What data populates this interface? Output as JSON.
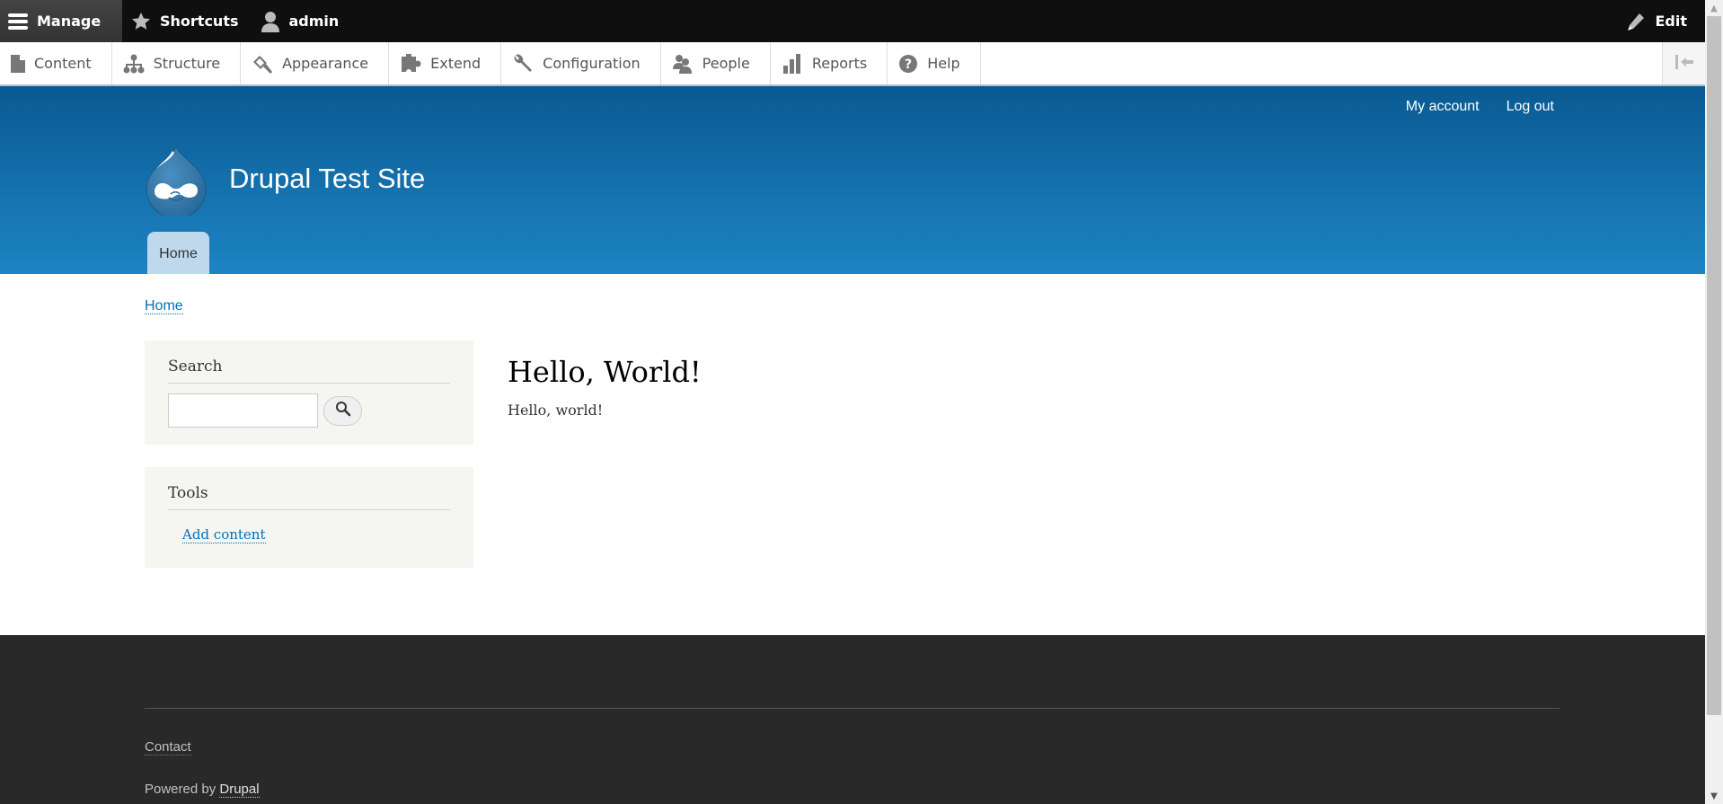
{
  "admin_toolbar": {
    "manage_label": "Manage",
    "shortcuts_label": "Shortcuts",
    "user_label": "admin",
    "edit_label": "Edit"
  },
  "admin_tray": {
    "items": [
      {
        "label": "Content",
        "icon": "file-icon"
      },
      {
        "label": "Structure",
        "icon": "sitemap-icon"
      },
      {
        "label": "Appearance",
        "icon": "paintbrush-icon"
      },
      {
        "label": "Extend",
        "icon": "puzzle-icon"
      },
      {
        "label": "Configuration",
        "icon": "wrench-icon"
      },
      {
        "label": "People",
        "icon": "people-icon"
      },
      {
        "label": "Reports",
        "icon": "bar-chart-icon"
      },
      {
        "label": "Help",
        "icon": "question-icon"
      }
    ],
    "toggle_icon": "collapse-orientation-icon"
  },
  "header": {
    "site_name": "Drupal Test Site",
    "secondary_menu": [
      "My account",
      "Log out"
    ],
    "primary_menu": [
      "Home"
    ],
    "colors": {
      "top": "#0a5a92",
      "bottom": "#1d84c3"
    }
  },
  "breadcrumb": [
    "Home"
  ],
  "sidebar": {
    "search_block": {
      "title": "Search",
      "input_value": "",
      "submit_icon": "search-icon"
    },
    "tools_block": {
      "title": "Tools",
      "links": [
        "Add content"
      ]
    }
  },
  "main": {
    "title": "Hello, World!",
    "body": "Hello, world!"
  },
  "footer": {
    "contact_label": "Contact",
    "powered_by_prefix": "Powered by",
    "powered_by_link": "Drupal"
  },
  "colors": {
    "link": "#0071b8",
    "footer_bg": "#292929",
    "sidebar_block_bg": "#f5f5f2"
  }
}
